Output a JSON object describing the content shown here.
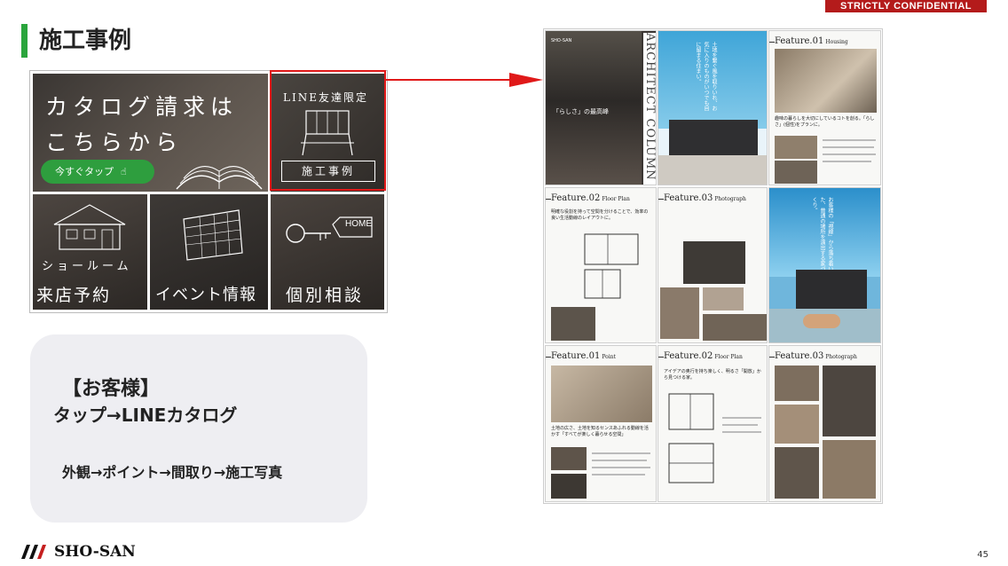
{
  "header": {
    "confidential": "STRICTLY CONFIDENTIAL",
    "title": "施工事例"
  },
  "menu": {
    "catalog_line1": "カタログ請求は",
    "catalog_line2": "こちらから",
    "tap_button": "今すぐタップ",
    "line_limited": "LINE友達限定",
    "cases_label": "施工事例",
    "showroom_line1": "ショールーム",
    "showroom_line2": "来店予約",
    "event_label": "イベント情報",
    "consult_label": "個別相談",
    "home_tag": "HOME"
  },
  "note": {
    "heading": "【お客様】",
    "subheading": "タップ→LINEカタログ",
    "flow": "外観→ポイント→間取り→施工写真"
  },
  "catalog_pages": {
    "cover_logo": "SHO-SAN",
    "cover_vertical": "ARCHITECT COLUMN",
    "cover_quote": "「らしさ」の最高峰",
    "cover_column": "土地を繋ぐ風を取りいれ、お気に入りのものがいつでも目に留まる住まい。",
    "row1_feature_title": "Feature.01",
    "row1_feature_sub": "Housing",
    "row1_feature_caption": "趣味の暮らしを大切にしているコトを創る。「らしさ」(個性)をプランに。",
    "row2_feature2_title": "Feature.02",
    "row2_feature2_sub": "Floor Plan",
    "row2_feature2_caption": "明確な役割を持って空間を分けることで、効率の良い生活動線のレイアウトに。",
    "row2_feature3_title": "Feature.03",
    "row2_feature3_sub": "Photograph",
    "row2_right_column": "お客様の「視線」から落ち着いた、普通の場所を演出する家づくり。",
    "row3_feature1_title": "Feature.01",
    "row3_feature1_sub": "Point",
    "row3_feature1_caption": "土地の広さ、土地を知るセンスあふれる動線を活かす「すべてが楽しく暮らせる空間」",
    "row3_feature2_title": "Feature.02",
    "row3_feature2_sub": "Floor Plan",
    "row3_feature2_caption": "アイデアの奥行を持ち楽しく、明るさ「開放」から見つける家。",
    "row3_feature3_title": "Feature.03",
    "row3_feature3_sub": "Photograph"
  },
  "footer": {
    "logo": "SHO-SAN",
    "page_number": "45"
  },
  "colors": {
    "accent_green": "#2aa53c",
    "highlight_red": "#e01919",
    "confidential_red": "#b41b1b"
  }
}
